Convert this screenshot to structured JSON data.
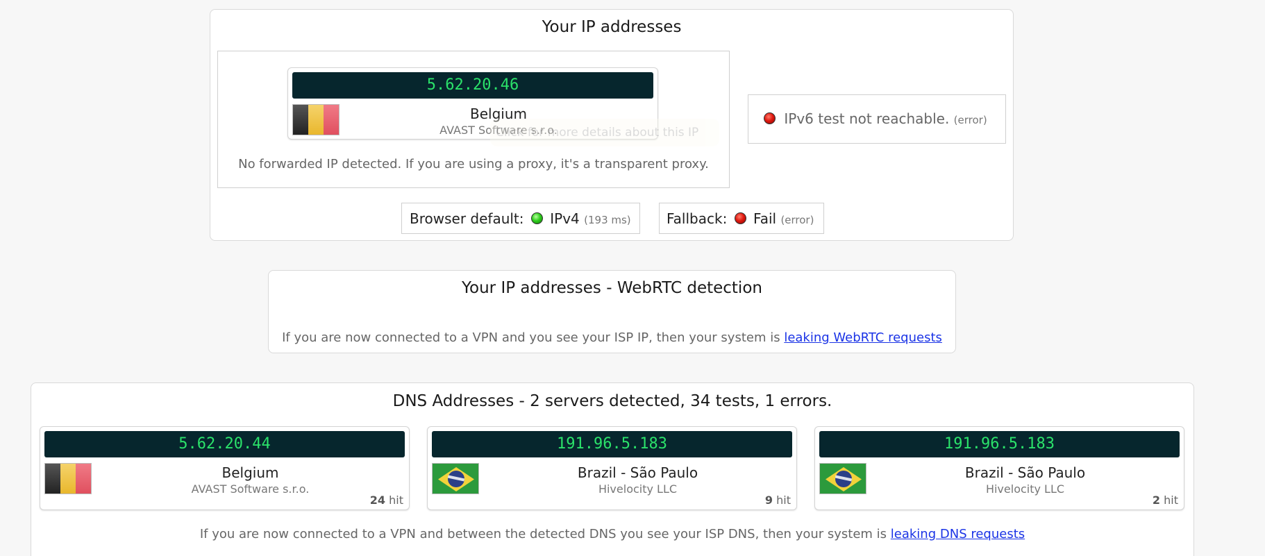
{
  "ip_panel": {
    "title": "Your IP addresses",
    "card": {
      "ip": "5.62.20.46",
      "country": "Belgium",
      "isp": "AVAST Software s.r.o.",
      "flag": "belgium-flag"
    },
    "hover_hint": "Click for more details about this IP",
    "forwarded_note": "No forwarded IP detected. If you are using a proxy, it's a transparent proxy.",
    "ipv6": {
      "text": "IPv6 test not reachable.",
      "status": "(error)"
    },
    "browser_default": {
      "label": "Browser default:",
      "protocol": "IPv4",
      "latency": "(193 ms)"
    },
    "fallback": {
      "label": "Fallback:",
      "result": "Fail",
      "status": "(error)"
    }
  },
  "webrtc_panel": {
    "title": "Your IP addresses - WebRTC detection",
    "note": "If you are now connected to a VPN and you see your ISP IP, then your system is ",
    "link": "leaking WebRTC requests"
  },
  "dns_panel": {
    "title": "DNS Addresses - 2 servers detected, 34 tests, 1 errors.",
    "cards": [
      {
        "ip": "5.62.20.44",
        "country": "Belgium",
        "isp": "AVAST Software s.r.o.",
        "hits": "24",
        "hit_label": "hit",
        "flag": "belgium-flag"
      },
      {
        "ip": "191.96.5.183",
        "country": "Brazil - São Paulo",
        "isp": "Hivelocity LLC",
        "hits": "9",
        "hit_label": "hit",
        "flag": "brazil-flag"
      },
      {
        "ip": "191.96.5.183",
        "country": "Brazil - São Paulo",
        "isp": "Hivelocity LLC",
        "hits": "2",
        "hit_label": "hit",
        "flag": "brazil-flag"
      }
    ],
    "note": "If you are now connected to a VPN and between the detected DNS you see your ISP DNS, then your system is ",
    "link": "leaking DNS requests"
  },
  "colors": {
    "ip_bar_bg": "#06262d",
    "ip_bar_text": "#2be26a",
    "link": "#1a33e6",
    "status_red": "#e01a10",
    "status_green": "#2fce1e"
  }
}
